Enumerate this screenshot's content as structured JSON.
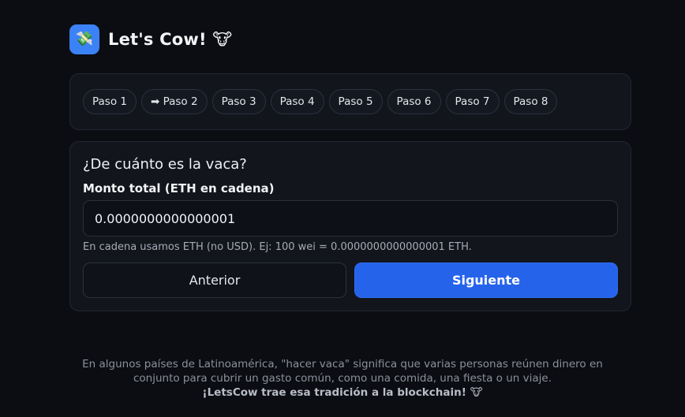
{
  "header": {
    "logo_glyph": "💸",
    "title": "Let's Cow! 🐮"
  },
  "steps": [
    {
      "label": "Paso 1"
    },
    {
      "label": "➡ Paso 2"
    },
    {
      "label": "Paso 3"
    },
    {
      "label": "Paso 4"
    },
    {
      "label": "Paso 5"
    },
    {
      "label": "Paso 6"
    },
    {
      "label": "Paso 7"
    },
    {
      "label": "Paso 8"
    }
  ],
  "form": {
    "heading": "¿De cuánto es la vaca?",
    "label": "Monto total (ETH en cadena)",
    "amount_value": "0.0000000000000001",
    "hint": "En cadena usamos ETH (no USD). Ej: 100 wei = 0.0000000000000001 ETH.",
    "prev_label": "Anterior",
    "next_label": "Siguiente"
  },
  "footer": {
    "line1": "En algunos países de Latinoamérica, \"hacer vaca\" significa que varias personas reúnen dinero en",
    "line2": "conjunto para cubrir un gasto común, como una comida, una fiesta o un viaje.",
    "line3": "¡LetsCow trae esa tradición a la blockchain! 🐮"
  },
  "colors": {
    "background": "#0b0d12",
    "card": "#12151c",
    "accent": "#2563eb",
    "logo_bg": "#3b82f6"
  }
}
